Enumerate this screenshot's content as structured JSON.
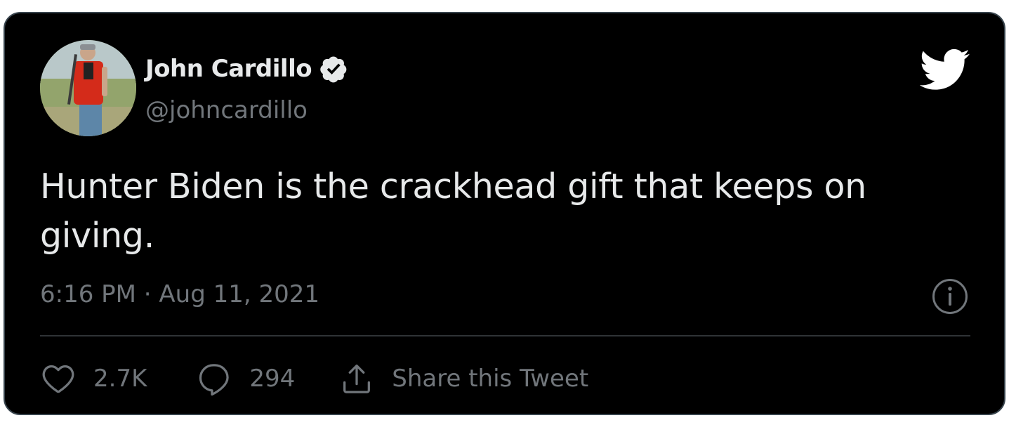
{
  "tweet": {
    "author": {
      "name": "John Cardillo",
      "handle": "@johncardillo",
      "verified": true
    },
    "text": "Hunter Biden is the crackhead gift that keeps on giving.",
    "timestamp": "6:16 PM · Aug 11, 2021",
    "actions": {
      "likes": "2.7K",
      "replies": "294",
      "share_label": "Share this Tweet"
    }
  },
  "icons": {
    "brand": "twitter-bird-icon",
    "verified": "verified-badge-icon",
    "info": "info-icon",
    "like": "heart-icon",
    "reply": "comment-icon",
    "share": "share-icon"
  },
  "colors": {
    "background": "#000000",
    "primary_text": "#e7e9ea",
    "secondary_text": "#71767b",
    "border": "#38444d",
    "twitter_logo": "#ffffff"
  }
}
